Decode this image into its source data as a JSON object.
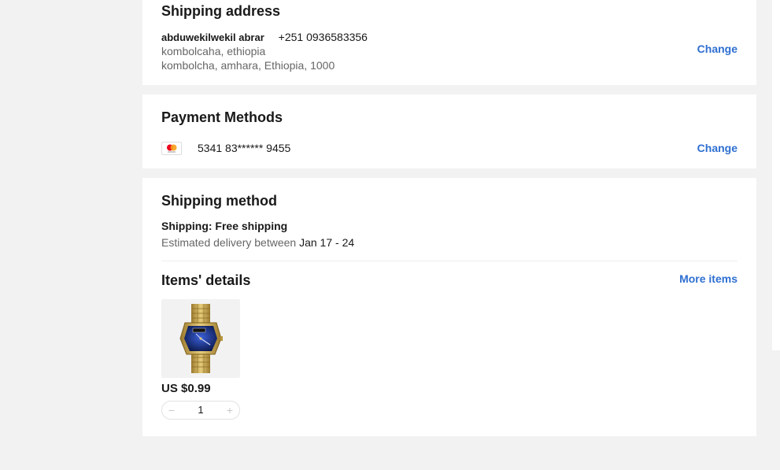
{
  "shipping_address": {
    "title": "Shipping address",
    "name": "abduwekilwekil abrar",
    "phone": "+251 0936583356",
    "line1": "kombolcaha, ethiopia",
    "line2": "kombolcha, amhara, Ethiopia, 1000",
    "change_label": "Change"
  },
  "payment": {
    "title": "Payment Methods",
    "card_brand_icon": "mastercard-icon",
    "card_number": "5341 83****** 9455",
    "change_label": "Change"
  },
  "shipping_method": {
    "title": "Shipping method",
    "shipping_label": "Shipping: Free shipping",
    "delivery_prefix": "Estimated delivery between",
    "delivery_range": "Jan 17 - 24"
  },
  "items": {
    "title": "Items' details",
    "more_label": "More items",
    "list": [
      {
        "image_icon": "gold-watch-image",
        "price": "US $0.99",
        "quantity": "1",
        "minus_symbol": "−",
        "plus_symbol": "+"
      }
    ]
  },
  "colors": {
    "link": "#2e6fd1",
    "page_bg": "#f2f2f2",
    "card_bg": "#ffffff",
    "text": "#191919",
    "muted_text": "#666666"
  }
}
